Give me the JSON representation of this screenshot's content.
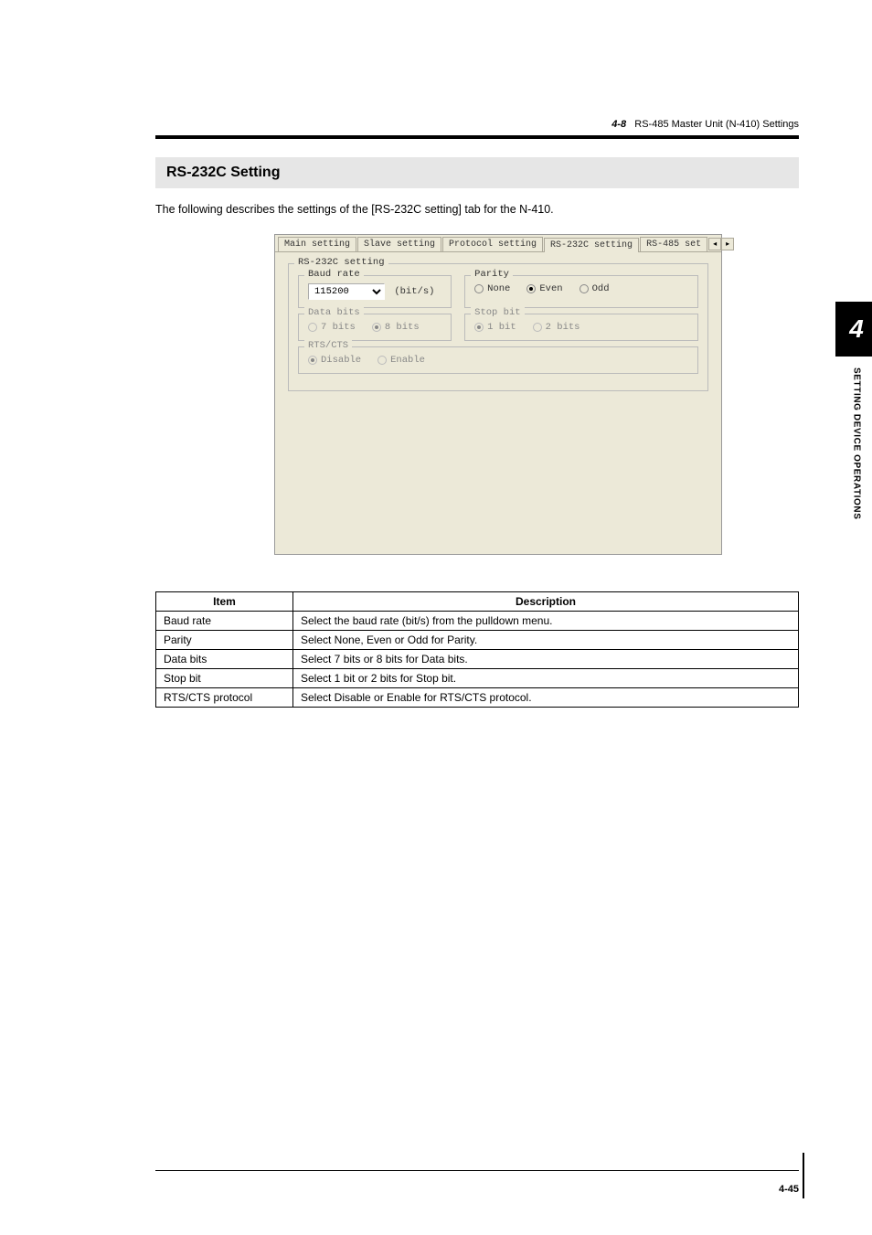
{
  "header": {
    "section_num": "4-8",
    "section_title": "RS-485 Master Unit (N-410) Settings"
  },
  "section_heading": "RS-232C Setting",
  "intro_text": "The following describes the settings of the [RS-232C setting] tab for the N-410.",
  "dialog": {
    "tabs": {
      "main": "Main setting",
      "slave": "Slave setting",
      "protocol": "Protocol setting",
      "rs232c": "RS-232C setting",
      "rs485": "RS-485 set"
    },
    "outer_legend": "RS-232C setting",
    "baud": {
      "legend": "Baud rate",
      "value": "115200",
      "unit": "(bit/s)"
    },
    "parity": {
      "legend": "Parity",
      "none": "None",
      "even": "Even",
      "odd": "Odd"
    },
    "databits": {
      "legend": "Data bits",
      "seven": "7 bits",
      "eight": "8 bits"
    },
    "stopbit": {
      "legend": "Stop bit",
      "one": "1 bit",
      "two": "2 bits"
    },
    "rtscts": {
      "legend": "RTS/CTS",
      "disable": "Disable",
      "enable": "Enable"
    }
  },
  "table": {
    "head_item": "Item",
    "head_desc": "Description",
    "rows": [
      {
        "item": "Baud rate",
        "desc": "Select the baud rate (bit/s) from the pulldown menu."
      },
      {
        "item": "Parity",
        "desc": "Select None, Even or Odd for Parity."
      },
      {
        "item": "Data bits",
        "desc": "Select 7 bits or 8 bits for Data bits."
      },
      {
        "item": "Stop bit",
        "desc": "Select 1 bit or 2 bits for Stop bit."
      },
      {
        "item": "RTS/CTS protocol",
        "desc": "Select Disable or Enable for RTS/CTS protocol."
      }
    ]
  },
  "sidebar": {
    "chapter_num": "4",
    "chapter_title": "SETTING DEVICE OPERATIONS"
  },
  "page_number": "4-45"
}
